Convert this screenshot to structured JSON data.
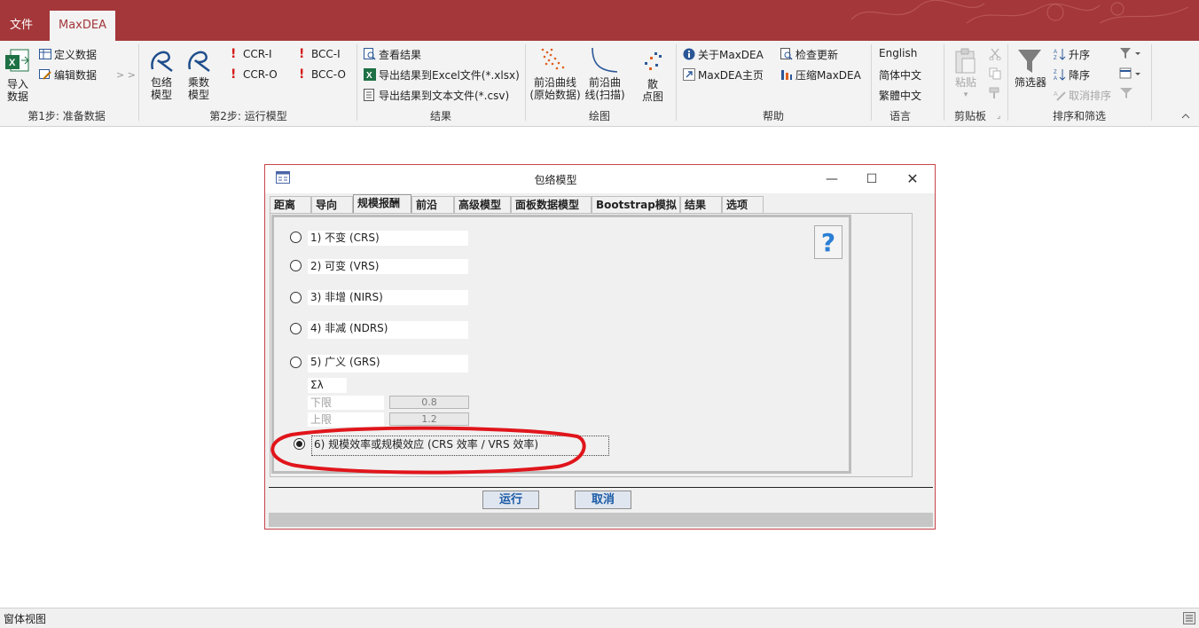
{
  "ribbon_tabs": {
    "file": "文件",
    "maxdea": "MaxDEA"
  },
  "ribbon": {
    "import": "导入数据",
    "import_l1": "导入",
    "import_l2": "数据",
    "define_data": "定义数据",
    "edit_data": "编辑数据",
    "arrows": "> >",
    "envelopment_l1": "包络",
    "envelopment_l2": "模型",
    "multiplier_l1": "乘数",
    "multiplier_l2": "模型",
    "ccr_i": "CCR-I",
    "ccr_o": "CCR-O",
    "bcc_i": "BCC-I",
    "bcc_o": "BCC-O",
    "view_results": "查看结果",
    "export_excel": "导出结果到Excel文件(*.xlsx)",
    "export_text": "导出结果到文本文件(*.csv)",
    "frontier_orig_l1": "前沿曲线",
    "frontier_orig_l2": "(原始数据)",
    "frontier_scan_l1": "前沿曲",
    "frontier_scan_l2": "线(扫描)",
    "scatter_l1": "散",
    "scatter_l2": "点图",
    "about": "关于MaxDEA",
    "homepage": "MaxDEA主页",
    "check_updates": "检查更新",
    "compress": "压缩MaxDEA",
    "lang_en": "English",
    "lang_sc": "简体中文",
    "lang_tc": "繁體中文",
    "paste_l1": "粘贴",
    "filter": "筛选器",
    "sort_asc": "升序",
    "sort_desc": "降序",
    "clear_sort": "取消排序",
    "groups": {
      "step1": "第1步: 准备数据",
      "step2": "第2步: 运行模型",
      "results": "结果",
      "plot": "绘图",
      "help": "帮助",
      "language": "语言",
      "clipboard": "剪贴板",
      "sort_filter": "排序和筛选"
    }
  },
  "status": {
    "text": "窗体视图"
  },
  "dialog": {
    "title": "包络模型",
    "tabs": [
      "距离",
      "导向",
      "规模报酬",
      "前沿",
      "高级模型",
      "面板数据模型",
      "Bootstrap模拟",
      "结果",
      "选项"
    ],
    "active_tab": "规模报酬",
    "help_glyph": "?",
    "options": [
      {
        "label": "1) 不变 (CRS)",
        "checked": false
      },
      {
        "label": "2) 可变 (VRS)",
        "checked": false
      },
      {
        "label": "3) 非增 (NIRS)",
        "checked": false
      },
      {
        "label": "4) 非减 (NDRS)",
        "checked": false
      },
      {
        "label": "5) 广义 (GRS)",
        "checked": false
      },
      {
        "label": "6) 规模效率或规模效应 (CRS 效率 / VRS 效率)",
        "checked": true
      }
    ],
    "grs": {
      "sigma_label": "Σλ",
      "lower_label": "下限",
      "lower_value": "0.8",
      "upper_label": "上限",
      "upper_value": "1.2"
    },
    "run_button": "运行",
    "cancel_button": "取消"
  },
  "colors": {
    "accent": "#a4373a",
    "annotation": "#e0151b"
  }
}
